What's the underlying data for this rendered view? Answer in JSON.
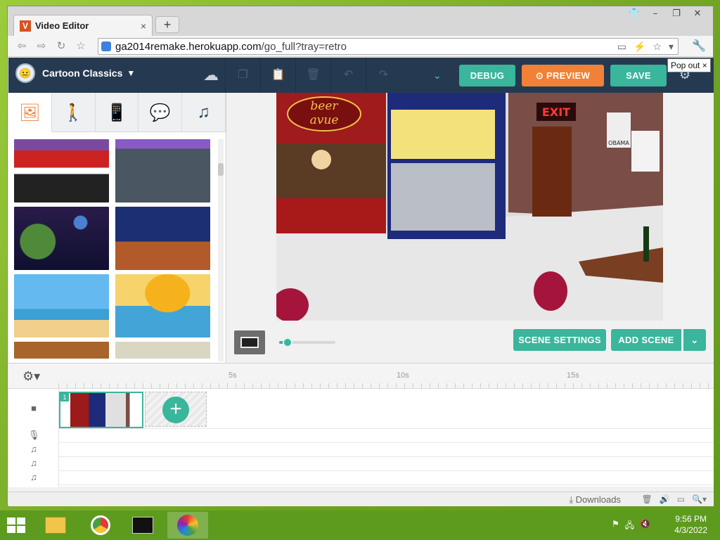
{
  "browser": {
    "tab_title": "Video Editor",
    "tab_favicon": "V",
    "url_host": "ga2014remake.herokuapp.com",
    "url_path": "/go_full?tray=retro"
  },
  "app": {
    "theme_name": "Cartoon Classics",
    "buttons": {
      "debug": "DEBUG",
      "preview": "PREVIEW",
      "save": "SAVE",
      "scene_settings": "SCENE SETTINGS",
      "add_scene": "ADD SCENE"
    },
    "popout_label": "Pop out",
    "asset_tabs": [
      {
        "name": "backgrounds",
        "icon": "image-icon",
        "glyph": "🖼",
        "active": true
      },
      {
        "name": "characters",
        "icon": "person-icon",
        "glyph": "🚶"
      },
      {
        "name": "props",
        "icon": "phone-icon",
        "glyph": "📱"
      },
      {
        "name": "text",
        "icon": "speech-bubble-icon",
        "glyph": "💬"
      },
      {
        "name": "audio",
        "icon": "music-note-icon",
        "glyph": "♫"
      }
    ],
    "stage_sign": {
      "top": "beer",
      "bottom": "avue"
    },
    "exit_sign": "EXIT",
    "poster_text": "OBAMA",
    "zoom_level": 0.15
  },
  "timeline": {
    "marks": [
      "5s",
      "10s",
      "15s"
    ],
    "scene_number": "1"
  },
  "downloads_bar": {
    "label": "Downloads"
  },
  "taskbar": {
    "time": "9:56 PM",
    "date": "4/3/2022"
  },
  "colors": {
    "accent": "#39b69c",
    "preview": "#f08136",
    "header": "#253a51"
  }
}
